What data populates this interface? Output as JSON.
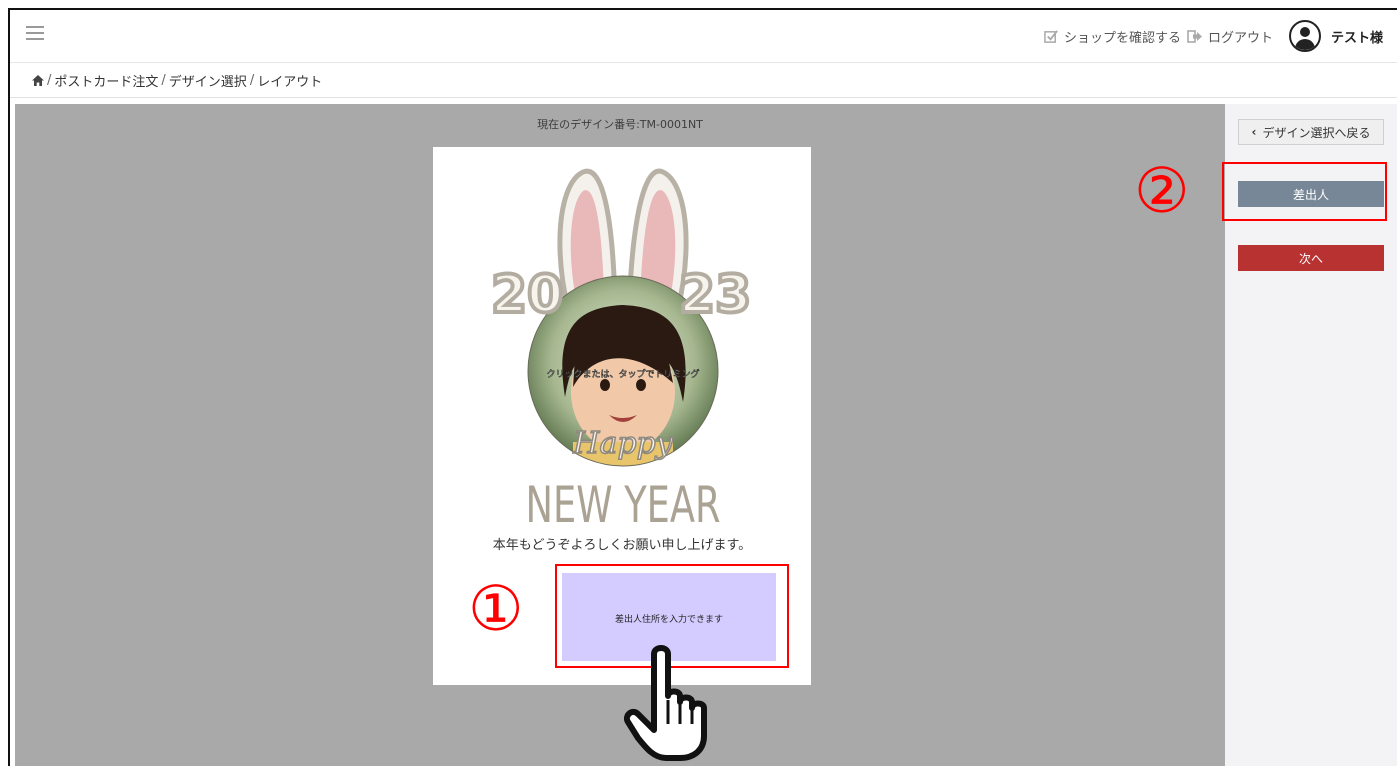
{
  "header": {
    "shop_link": "ショップを確認する",
    "logout_link": "ログアウト",
    "user_name": "テスト様"
  },
  "breadcrumb": {
    "items": [
      "ポストカード注文",
      "デザイン選択",
      "レイアウト"
    ]
  },
  "canvas": {
    "design_number": "現在のデザイン番号:TM-0001NT"
  },
  "card": {
    "year_left": "20",
    "year_right": "23",
    "photo_hint": "クリックまたは、タップでトリミング",
    "happy_text": "Happy",
    "new_year_text": "NEW YEAR",
    "greeting": "本年もどうぞよろしくお願い申し上げます。",
    "sender_placeholder": "差出人住所を入力できます"
  },
  "sidebar": {
    "back_label": "デザイン選択へ戻る",
    "sender_label": "差出人",
    "next_label": "次へ"
  },
  "annotations": {
    "marker_1": "①",
    "marker_2": "②"
  },
  "colors": {
    "canvas_bg": "#a9a9a9",
    "sender_button": "#778797",
    "next_button": "#b83232",
    "sender_area": "#d4ccff",
    "highlight": "#ff0000"
  }
}
